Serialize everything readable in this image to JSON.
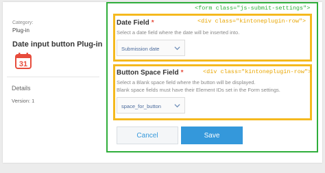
{
  "sidebar": {
    "category_label": "Category:",
    "category_value": "Plug-in",
    "plugin_name": "Date input button Plug-in",
    "calendar_day": "31",
    "details_label": "Details",
    "version": "Version: 1"
  },
  "annotations": {
    "form": "<form class=\"js-submit-settings\">",
    "row1": "<div class=\"kintoneplugin-row\">",
    "row2": "<div class=\"kintoneplugin-row\">"
  },
  "date_field": {
    "title": "Date Field",
    "required_mark": "*",
    "description": "Select a date field where the date will be inserted into.",
    "selected": "Submission date"
  },
  "space_field": {
    "title": "Button Space Field",
    "required_mark": "*",
    "description_1": "Select a Blank space field where the button will be displayed.",
    "description_2": "Blank space fields must have their Element IDs set in the Form settings.",
    "selected": "space_for_button"
  },
  "buttons": {
    "cancel": "Cancel",
    "save": "Save"
  },
  "colors": {
    "form_outline": "#2eae3a",
    "row_outline": "#f5b91e",
    "accent": "#3498db",
    "required": "#e74c3c"
  }
}
